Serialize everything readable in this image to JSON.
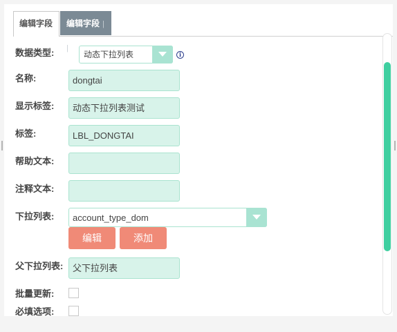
{
  "tabs": [
    {
      "label": "编辑字段"
    },
    {
      "label": "编辑字段",
      "extra": "| |"
    }
  ],
  "form": {
    "data_type": {
      "label": "数据类型:",
      "value": "动态下拉列表"
    },
    "name": {
      "label": "名称:",
      "value": "dongtai"
    },
    "display_label": {
      "label": "显示标签:",
      "value": "动态下拉列表测试"
    },
    "tag": {
      "label": "标签:",
      "value": "LBL_DONGTAI"
    },
    "help_text": {
      "label": "帮助文本:",
      "value": ""
    },
    "comment_text": {
      "label": "注释文本:",
      "value": ""
    },
    "dropdown_list": {
      "label": "下拉列表:",
      "value": "account_type_dom"
    },
    "buttons": {
      "edit": "编辑",
      "add": "添加"
    },
    "parent_dropdown": {
      "label": "父下拉列表:",
      "value": "父下拉列表"
    },
    "mass_update": {
      "label": "批量更新:"
    },
    "required": {
      "label": "必填选项:"
    }
  },
  "icons": {
    "info": "info-icon",
    "dropdown_arrow": "chevron-down-icon"
  },
  "colors": {
    "accent": "#3fcfa0",
    "field_bg": "#d8f3ea",
    "button": "#f08a77",
    "tab_active": "#7b8a95"
  }
}
